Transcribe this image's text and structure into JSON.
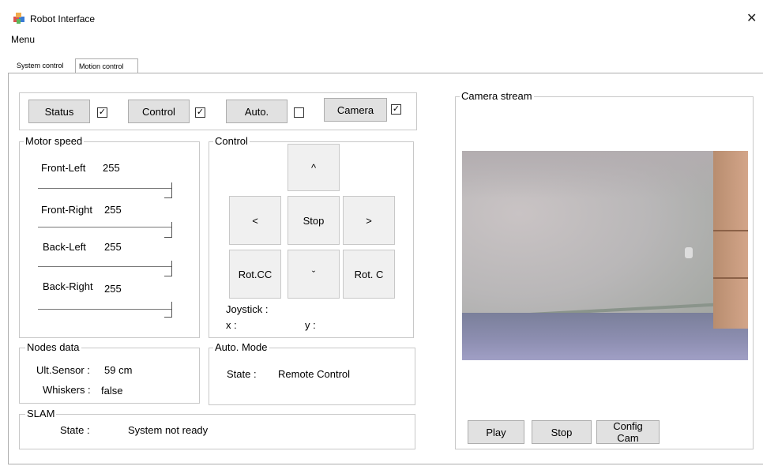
{
  "window": {
    "title": "Robot Interface",
    "close_glyph": "✕",
    "icon": "app-cubes-icon"
  },
  "menu": {
    "label": "Menu"
  },
  "tabs": [
    {
      "label": "System control",
      "active": false
    },
    {
      "label": "Motion control",
      "active": true
    }
  ],
  "toolbar": {
    "buttons": [
      {
        "label": "Status",
        "checked": true
      },
      {
        "label": "Control",
        "checked": true
      },
      {
        "label": "Auto.",
        "checked": false
      },
      {
        "label": "Camera",
        "checked": true
      }
    ],
    "check_glyph": "✓"
  },
  "motor_speed": {
    "title": "Motor speed",
    "motors": [
      {
        "label": "Front-Left",
        "value": "255",
        "level": 1.0
      },
      {
        "label": "Front-Right",
        "value": "255",
        "level": 1.0
      },
      {
        "label": "Back-Left",
        "value": "255",
        "level": 1.0
      },
      {
        "label": "Back-Right",
        "value": "255",
        "level": 1.0
      }
    ]
  },
  "control": {
    "title": "Control",
    "up": "^",
    "left": "<",
    "stop": "Stop",
    "right": ">",
    "rot_cc": "Rot.CC",
    "down": "ˇ",
    "rot_c": "Rot. C",
    "joystick_label": "Joystick :",
    "x_label": "x :",
    "y_label": "y :"
  },
  "nodes_data": {
    "title": "Nodes data",
    "ult_label": "Ult.Sensor :",
    "ult_value": "59 cm",
    "whiskers_label": "Whiskers :",
    "whiskers_value": "false"
  },
  "auto_mode": {
    "title": "Auto. Mode",
    "state_label": "State :",
    "state_value": "Remote Control"
  },
  "slam": {
    "title": "SLAM",
    "state_label": "State :",
    "state_value": "System not ready"
  },
  "camera": {
    "title": "Camera stream",
    "play": "Play",
    "stop": "Stop",
    "config": "Config Cam"
  }
}
